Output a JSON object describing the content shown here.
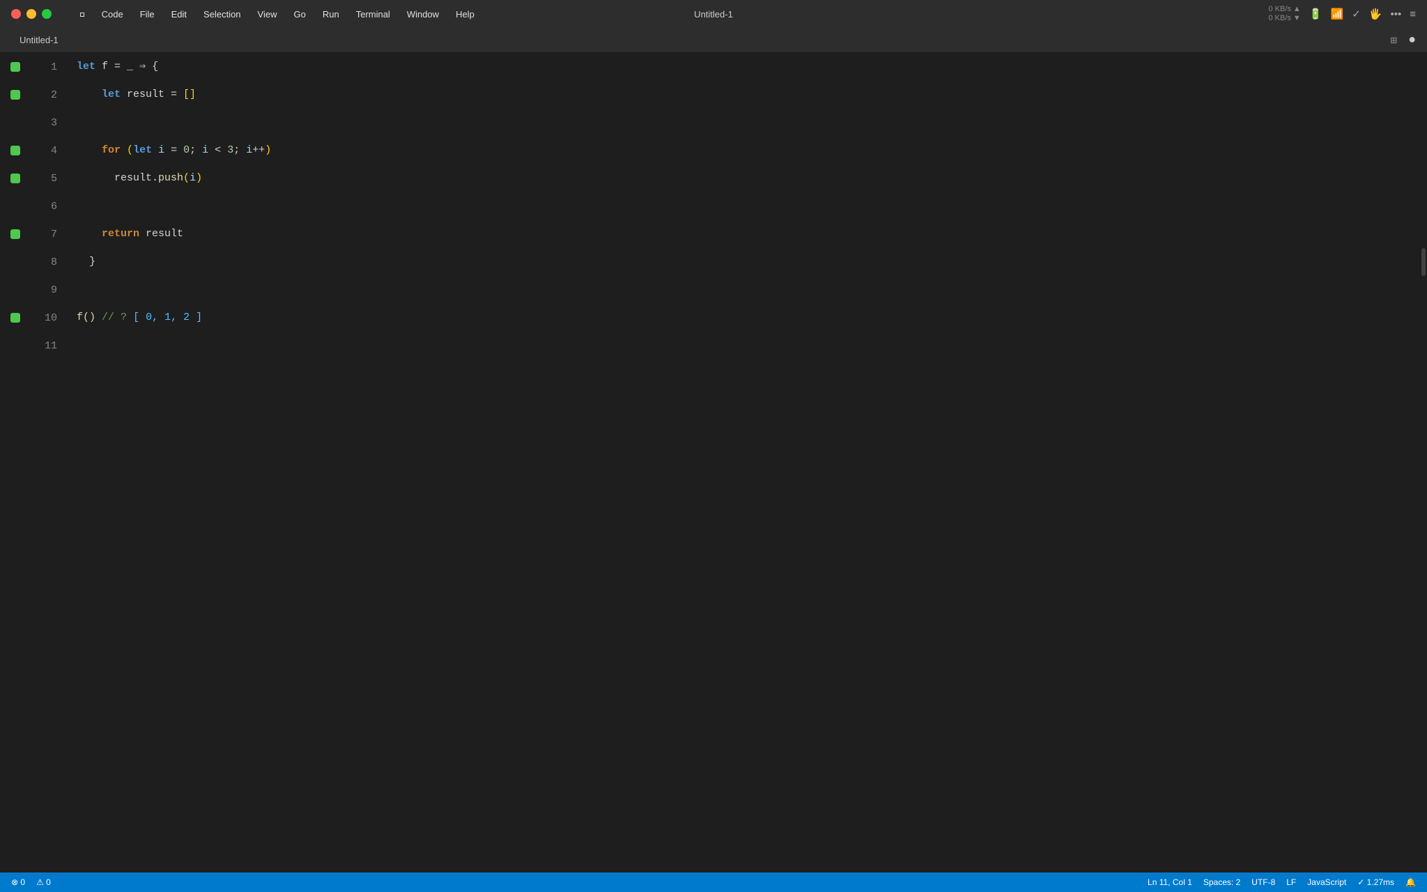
{
  "titlebar": {
    "title": "Untitled-1",
    "apple_label": "",
    "menu_items": [
      "Code",
      "File",
      "Edit",
      "Selection",
      "View",
      "Go",
      "Run",
      "Terminal",
      "Window",
      "Help"
    ],
    "network_status": "0 KB/s\n0 KB/s",
    "tab_title": "Untitled-1"
  },
  "tab": {
    "label": "Untitled-1"
  },
  "editor": {
    "lines": [
      {
        "number": "1",
        "has_bp": true,
        "tokens": [
          {
            "type": "kw-let",
            "text": "let"
          },
          {
            "type": "plain",
            "text": " f = _ "
          },
          {
            "type": "arrow",
            "text": "⇒"
          },
          {
            "type": "plain",
            "text": " {"
          }
        ]
      },
      {
        "number": "2",
        "has_bp": true,
        "tokens": [
          {
            "type": "plain",
            "text": "    "
          },
          {
            "type": "kw-let",
            "text": "let"
          },
          {
            "type": "plain",
            "text": " result = "
          },
          {
            "type": "str-bracket",
            "text": "[]"
          }
        ]
      },
      {
        "number": "3",
        "has_bp": false,
        "tokens": []
      },
      {
        "number": "4",
        "has_bp": true,
        "tokens": [
          {
            "type": "plain",
            "text": "    "
          },
          {
            "type": "kw-for",
            "text": "for"
          },
          {
            "type": "plain",
            "text": " "
          },
          {
            "type": "paren",
            "text": "("
          },
          {
            "type": "kw-let",
            "text": "let"
          },
          {
            "type": "plain",
            "text": " "
          },
          {
            "type": "var",
            "text": "i"
          },
          {
            "type": "plain",
            "text": " = "
          },
          {
            "type": "num",
            "text": "0"
          },
          {
            "type": "plain",
            "text": "; "
          },
          {
            "type": "var",
            "text": "i"
          },
          {
            "type": "plain",
            "text": " < "
          },
          {
            "type": "num",
            "text": "3"
          },
          {
            "type": "plain",
            "text": "; "
          },
          {
            "type": "var",
            "text": "i"
          },
          {
            "type": "plain",
            "text": "++"
          },
          {
            "type": "paren",
            "text": ")"
          }
        ]
      },
      {
        "number": "5",
        "has_bp": true,
        "tokens": [
          {
            "type": "plain",
            "text": "      result."
          },
          {
            "type": "method",
            "text": "push"
          },
          {
            "type": "paren",
            "text": "("
          },
          {
            "type": "var",
            "text": "i"
          },
          {
            "type": "paren",
            "text": ")"
          }
        ]
      },
      {
        "number": "6",
        "has_bp": false,
        "tokens": []
      },
      {
        "number": "7",
        "has_bp": true,
        "tokens": [
          {
            "type": "plain",
            "text": "    "
          },
          {
            "type": "kw-return",
            "text": "return"
          },
          {
            "type": "plain",
            "text": " result"
          }
        ]
      },
      {
        "number": "8",
        "has_bp": false,
        "tokens": [
          {
            "type": "plain",
            "text": "  }"
          }
        ]
      },
      {
        "number": "9",
        "has_bp": false,
        "tokens": []
      },
      {
        "number": "10",
        "has_bp": true,
        "tokens": [
          {
            "type": "f-call",
            "text": "f()"
          },
          {
            "type": "plain",
            "text": " "
          },
          {
            "type": "comment",
            "text": "// ?"
          },
          {
            "type": "plain",
            "text": " "
          },
          {
            "type": "result-val",
            "text": "[ 0, 1, 2 ]"
          }
        ]
      },
      {
        "number": "11",
        "has_bp": false,
        "tokens": []
      }
    ]
  },
  "statusbar": {
    "errors": "⊗ 0",
    "warnings": "⚠ 0",
    "position": "Ln 11, Col 1",
    "spaces": "Spaces: 2",
    "encoding": "UTF-8",
    "line_ending": "LF",
    "language": "JavaScript",
    "timing": "✓ 1.27ms",
    "notifications_icon": "🔔"
  }
}
